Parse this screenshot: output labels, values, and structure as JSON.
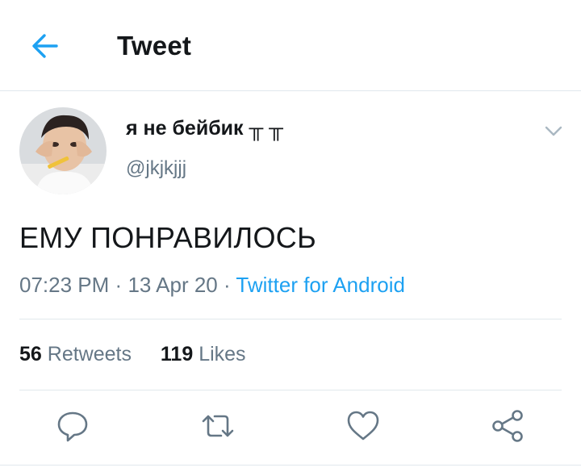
{
  "header": {
    "title": "Tweet",
    "back_icon": "arrow-left-icon"
  },
  "tweet": {
    "author": {
      "name": "я не бейбик ╥ ╥",
      "handle": "@jkjkjjj"
    },
    "text": "ЕМУ ПОНРАВИЛОСЬ",
    "time": "07:23 PM",
    "date": "13 Apr 20",
    "source": "Twitter for Android",
    "separator": "·",
    "stats": {
      "retweets_count": "56",
      "retweets_label": "Retweets",
      "likes_count": "119",
      "likes_label": "Likes"
    },
    "actions": [
      "reply-icon",
      "retweet-icon",
      "like-icon",
      "share-icon"
    ]
  },
  "colors": {
    "accent": "#1da1f2",
    "text": "#14171a",
    "secondary": "#657786",
    "divider": "#e1e8ed",
    "icon": "#657786"
  }
}
